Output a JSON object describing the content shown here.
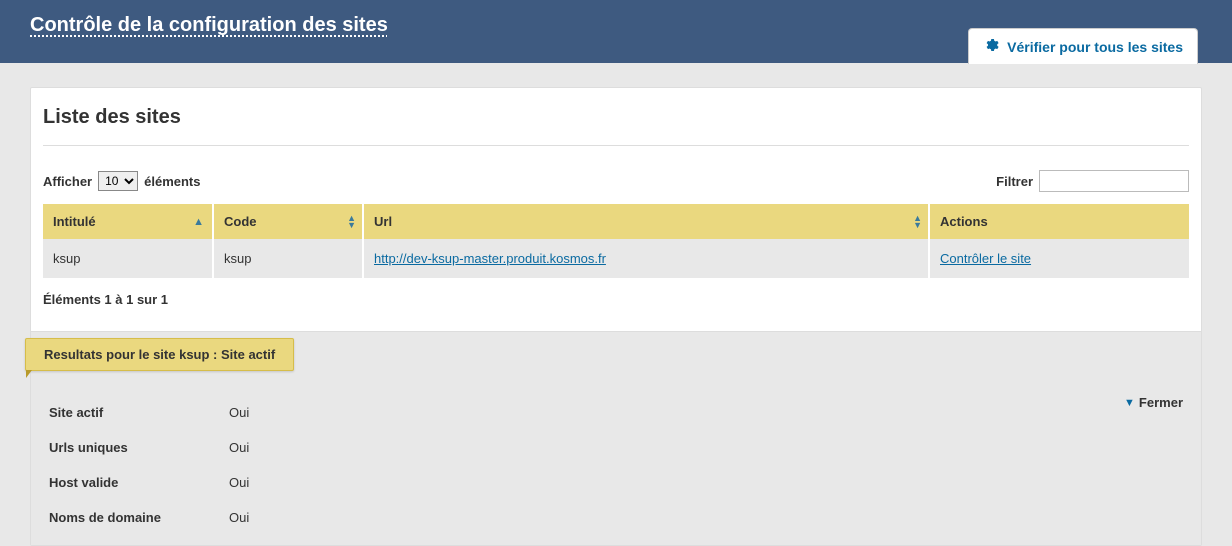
{
  "header": {
    "title": "Contrôle de la configuration des sites",
    "verify_all": "Vérifier pour tous les sites"
  },
  "panel": {
    "title": "Liste des sites"
  },
  "length_ctrl": {
    "prefix": "Afficher",
    "suffix": "éléments",
    "value": "10",
    "options": [
      "10"
    ]
  },
  "filter": {
    "label": "Filtrer",
    "value": ""
  },
  "columns": {
    "intitule": "Intitulé",
    "code": "Code",
    "url": "Url",
    "actions": "Actions"
  },
  "rows": [
    {
      "intitule": "ksup",
      "code": "ksup",
      "url": "http://dev-ksup-master.produit.kosmos.fr",
      "action_label": "Contrôler le site"
    }
  ],
  "info": "Éléments 1 à 1 sur 1",
  "results": {
    "tab": "Resultats pour le site ksup : Site actif",
    "close": "Fermer",
    "items": [
      {
        "label": "Site actif",
        "value": "Oui"
      },
      {
        "label": "Urls uniques",
        "value": "Oui"
      },
      {
        "label": "Host valide",
        "value": "Oui"
      },
      {
        "label": "Noms de domaine",
        "value": "Oui"
      }
    ]
  }
}
